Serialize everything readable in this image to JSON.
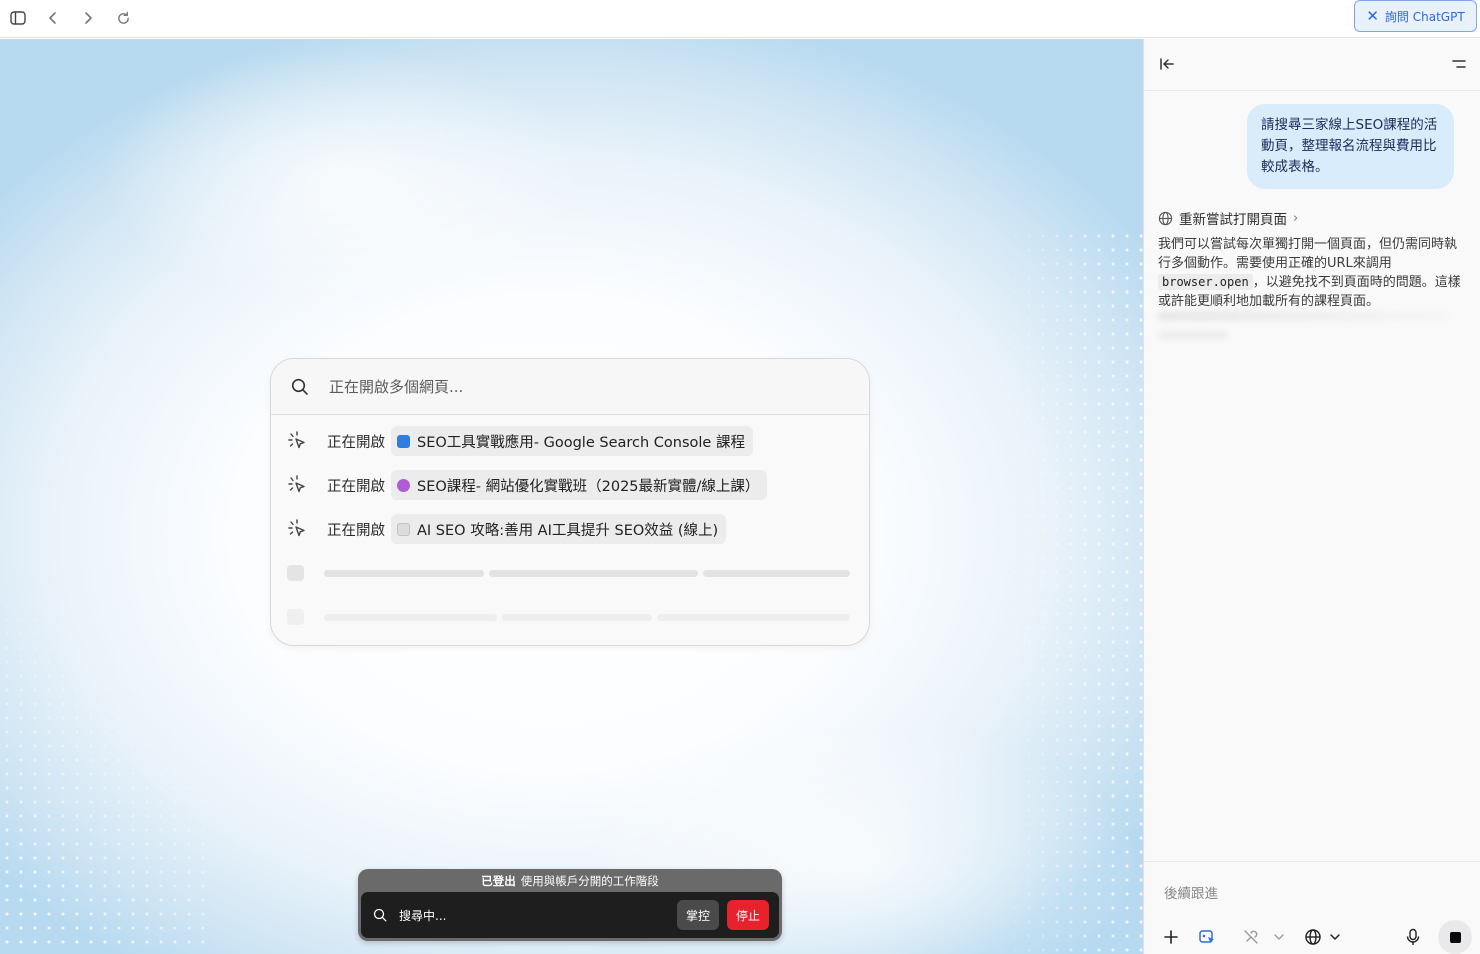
{
  "toolbar": {
    "ask_button_label": "詢問 ChatGPT"
  },
  "card": {
    "header": "正在開啟多個網頁...",
    "rows": [
      {
        "verb": "正在開啟",
        "title": "SEO工具實戰應用- Google Search Console 課程",
        "favicon_color": "#2f7de1"
      },
      {
        "verb": "正在開啟",
        "title": "SEO課程- 網站優化實戰班（2025最新實體/線上課）",
        "favicon_color": "#b15bd6"
      },
      {
        "verb": "正在開啟",
        "title": "AI SEO 攻略:善用 AI工具提升 SEO效益 (線上)",
        "favicon_color": "#cfcfcf"
      }
    ]
  },
  "control_bar": {
    "status_bold": "已登出",
    "status_text": "使用與帳戶分開的工作階段",
    "searching": "搜尋中...",
    "take_control": "掌控",
    "stop": "停止"
  },
  "panel": {
    "user_message": "請搜尋三家線上SEO課程的活動頁，整理報名流程與費用比較成表格。",
    "action_label": "重新嘗試打開頁面",
    "assistant_part1": "我們可以嘗試每次單獨打開一個頁面，但仍需同時執行多個動作。需要使用正確的URL來調用",
    "assistant_code": "browser.open",
    "assistant_part2": "，以避免找不到頁面時的問題。這樣或許能更順利地加載所有的課程頁面。",
    "composer_placeholder": "後續跟進"
  },
  "colors": {
    "accent": "#2a6ad9",
    "stop_red": "#e8222d",
    "bubble": "#d9ecfb"
  }
}
